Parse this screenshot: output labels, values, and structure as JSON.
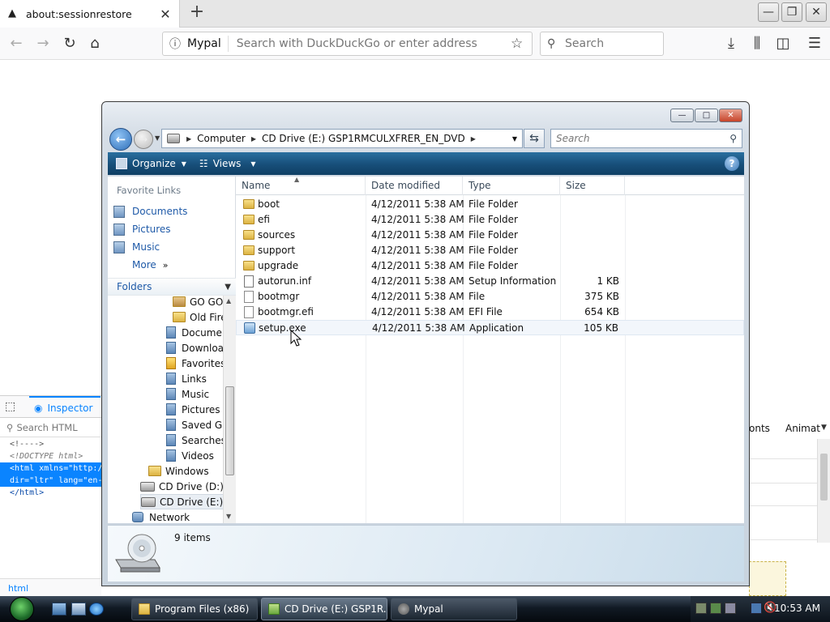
{
  "browser": {
    "tab_title": "about:sessionrestore",
    "site_name": "Mypal",
    "address_placeholder": "Search with DuckDuckGo or enter address",
    "search_placeholder": "Search"
  },
  "devtools": {
    "inspector_label": "Inspector",
    "search_placeholder": "Search HTML",
    "code_lines": [
      "<!---->",
      "<!DOCTYPE html>",
      "<html xmlns=\"http://",
      "dir=\"ltr\" lang=\"en-",
      "</html>"
    ],
    "breadcrumb": "html",
    "right_tab_1": "onts",
    "right_tab_2": "Animat"
  },
  "explorer": {
    "address": {
      "crumbs": [
        "Computer",
        "CD Drive (E:) GSP1RMCULXFRER_EN_DVD"
      ]
    },
    "search_placeholder": "Search",
    "toolbar": {
      "organize": "Organize",
      "views": "Views"
    },
    "favorites": {
      "header": "Favorite Links",
      "items": [
        "Documents",
        "Pictures",
        "Music"
      ],
      "more": "More"
    },
    "folders_header": "Folders",
    "tree": [
      "GO GO",
      "Old Fire",
      "Documen",
      "Downloa",
      "Favorites",
      "Links",
      "Music",
      "Pictures",
      "Saved Ga",
      "Searches",
      "Videos",
      "Windows",
      "CD Drive (D:)",
      "CD Drive (E:)",
      "Network"
    ],
    "columns": [
      "Name",
      "Date modified",
      "Type",
      "Size"
    ],
    "files": [
      {
        "name": "boot",
        "date": "4/12/2011 5:38 AM",
        "type": "File Folder",
        "size": ""
      },
      {
        "name": "efi",
        "date": "4/12/2011 5:38 AM",
        "type": "File Folder",
        "size": ""
      },
      {
        "name": "sources",
        "date": "4/12/2011 5:38 AM",
        "type": "File Folder",
        "size": ""
      },
      {
        "name": "support",
        "date": "4/12/2011 5:38 AM",
        "type": "File Folder",
        "size": ""
      },
      {
        "name": "upgrade",
        "date": "4/12/2011 5:38 AM",
        "type": "File Folder",
        "size": ""
      },
      {
        "name": "autorun.inf",
        "date": "4/12/2011 5:38 AM",
        "type": "Setup Information",
        "size": "1 KB"
      },
      {
        "name": "bootmgr",
        "date": "4/12/2011 5:38 AM",
        "type": "File",
        "size": "375 KB"
      },
      {
        "name": "bootmgr.efi",
        "date": "4/12/2011 5:38 AM",
        "type": "EFI File",
        "size": "654 KB"
      },
      {
        "name": "setup.exe",
        "date": "4/12/2011 5:38 AM",
        "type": "Application",
        "size": "105 KB"
      }
    ],
    "status": "9 items"
  },
  "taskbar": {
    "buttons": [
      "Program Files (x86)",
      "CD Drive (E:) GSP1R...",
      "Mypal"
    ],
    "clock": "10:53 AM"
  },
  "colors": {
    "accent": "#0a84ff",
    "explorer_toolbar": "#174e79",
    "link": "#1f5aa8"
  }
}
